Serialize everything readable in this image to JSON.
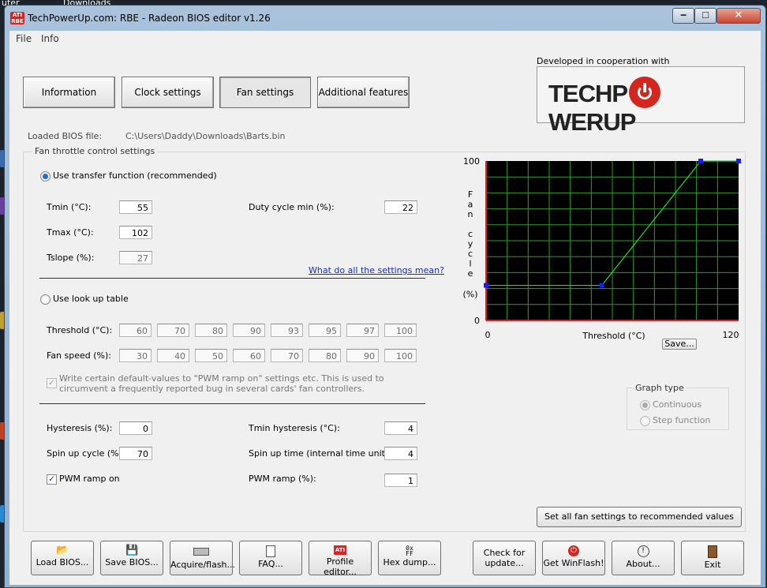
{
  "desktop": {
    "top_label": "uter",
    "downloads": "Downloads"
  },
  "window": {
    "title": "TechPowerUp.com: RBE - Radeon BIOS editor v1.26",
    "icon_text": "ATI RBE",
    "min_glyph": "━",
    "max_glyph": "☐",
    "close_glyph": "✕"
  },
  "menu": [
    "File",
    "Info"
  ],
  "tabs": [
    {
      "label": "Information",
      "active": false
    },
    {
      "label": "Clock settings",
      "active": false
    },
    {
      "label": "Fan settings",
      "active": true
    },
    {
      "label": "Additional features",
      "active": false
    }
  ],
  "logo": {
    "dev_label": "Developed in cooperation with",
    "text_left": "TECHP",
    "text_right": "WERUP"
  },
  "bios": {
    "label": "Loaded BIOS file:",
    "path": "C:\\Users\\Daddy\\Downloads\\Barts.bin"
  },
  "fan": {
    "group_label": "Fan throttle control settings",
    "transfer_radio": "Use transfer function (recommended)",
    "tmin_label": "Tmin (°C):",
    "tmin": "55",
    "tmax_label": "Tmax (°C):",
    "tmax": "102",
    "tslope_label": "Tslope (%):",
    "tslope": "27",
    "duty_label": "Duty cycle min (%):",
    "duty": "22",
    "help_link": "What do all the settings mean?",
    "lookup_radio": "Use look up table",
    "threshold_label": "Threshold (°C):",
    "thresholds": [
      "60",
      "70",
      "80",
      "90",
      "93",
      "95",
      "97",
      "100"
    ],
    "fanspeed_label": "Fan speed (%):",
    "fanspeeds": [
      "30",
      "40",
      "50",
      "60",
      "70",
      "80",
      "90",
      "100"
    ],
    "pwm_bug_text_1": "Write certain default-values to \"PWM ramp on\" settings etc. This is used to",
    "pwm_bug_text_2": "circumvent a frequently reported bug in several cards' fan controllers.",
    "hysteresis_label": "Hysteresis (%):",
    "hysteresis": "0",
    "spinup_cycle_label": "Spin up cycle (%):",
    "spinup_cycle": "70",
    "pwm_ramp_on_label": "PWM ramp on",
    "tmin_hyst_label": "Tmin hysteresis (°C):",
    "tmin_hyst": "4",
    "spinup_time_label": "Spin up time (internal time units):",
    "spinup_time": "4",
    "pwm_ramp_label": "PWM ramp (%):",
    "pwm_ramp": "1"
  },
  "graph": {
    "save_label": "Save...",
    "group_label": "Graph type",
    "continuous": "Continuous",
    "step": "Step function",
    "recommend_button": "Set all fan settings to recommended values"
  },
  "chart_data": {
    "type": "line",
    "xlabel": "Threshold (°C)",
    "ylabel_letters": [
      "F",
      "a",
      "n",
      "",
      "c",
      "y",
      "c",
      "l",
      "e"
    ],
    "ylabel_unit": "(%)",
    "xlim": [
      0,
      120
    ],
    "ylim": [
      0,
      100
    ],
    "x_tick_labels": [
      "0",
      "120"
    ],
    "y_tick_labels": [
      "100",
      "0"
    ],
    "grid": true,
    "points": [
      {
        "x": 0,
        "y": 22
      },
      {
        "x": 55,
        "y": 22
      },
      {
        "x": 102,
        "y": 100
      },
      {
        "x": 120,
        "y": 100
      }
    ],
    "colors": {
      "background": "#000000",
      "grid": "#2e9a2e",
      "line": "#22dd22",
      "axis": "#e02020",
      "marker": "#1a1aff"
    }
  },
  "bottom_buttons": [
    {
      "label": "Load BIOS...",
      "icon": "folder-icon"
    },
    {
      "label": "Save BIOS...",
      "icon": "floppy-icon"
    },
    {
      "label": "Acquire/flash...",
      "icon": "chip-icon"
    },
    {
      "label": "FAQ...",
      "icon": "document-icon"
    },
    {
      "label": "Profile editor...",
      "icon": "ati-icon"
    },
    {
      "label": "Hex dump...",
      "icon": "hex-icon"
    },
    {
      "label": "Check for update...",
      "icon": ""
    },
    {
      "label": "Get WinFlash!",
      "icon": "power-icon"
    },
    {
      "label": "About...",
      "icon": "clock-icon"
    },
    {
      "label": "Exit",
      "icon": "exit-door-icon"
    }
  ]
}
